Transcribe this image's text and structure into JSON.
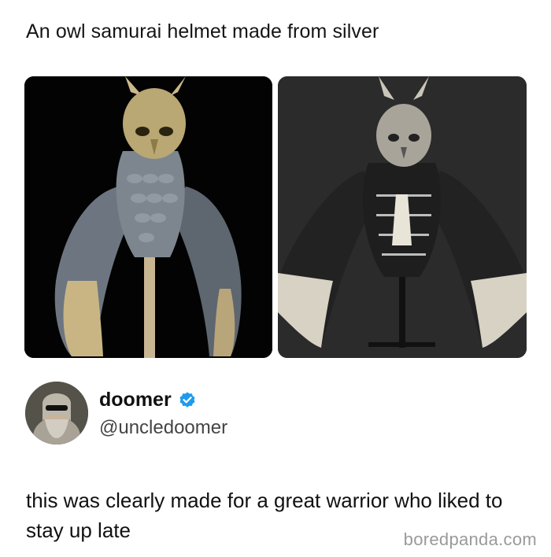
{
  "post": {
    "title": "An owl samurai helmet made from silver"
  },
  "images": {
    "left_alt": "",
    "right_alt": ""
  },
  "tweet": {
    "display_name": "doomer",
    "handle": "@uncledoomer",
    "verified": true,
    "text": "this was clearly made for a great warrior who liked to stay up late"
  },
  "watermark": "boredpanda.com",
  "colors": {
    "verified_badge": "#1d9bf0",
    "watermark": "#9a9a9a",
    "left_photo_bg": "#030303",
    "right_photo_bg": "#2b2b2b"
  },
  "icons": {
    "badge": "verified-check-icon"
  }
}
